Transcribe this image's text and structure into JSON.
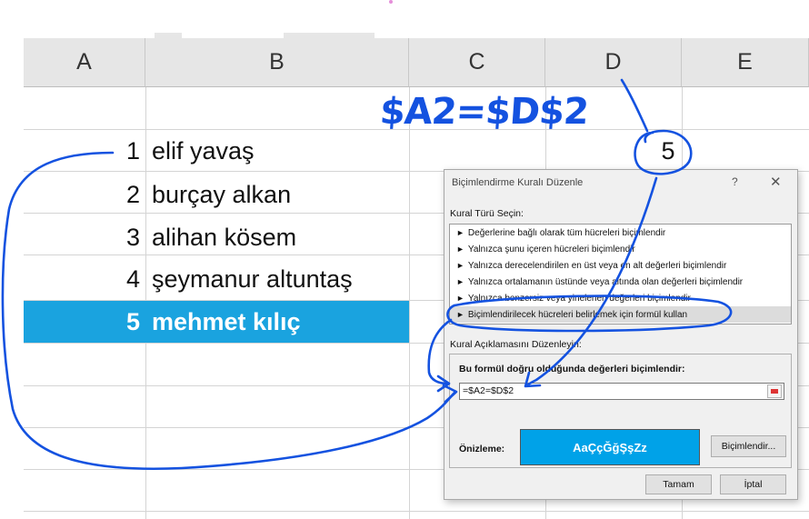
{
  "sheet": {
    "columns": [
      "A",
      "B",
      "C",
      "D",
      "E"
    ],
    "rows": [
      {
        "num": "1",
        "name": "elif yavaş"
      },
      {
        "num": "2",
        "name": "burçay alkan"
      },
      {
        "num": "3",
        "name": "alihan kösem"
      },
      {
        "num": "4",
        "name": "şeymanur altuntaş"
      },
      {
        "num": "5",
        "name": "mehmet kılıç"
      }
    ],
    "d1_value": "5",
    "selected_row_highlight": "#1aa3df"
  },
  "dialog": {
    "title": "Biçimlendirme Kuralı Düzenle",
    "help": "?",
    "close": "✕",
    "rule_type_label": "Kural Türü Seçin:",
    "rule_types": [
      "Değerlerine bağlı olarak tüm hücreleri biçimlendir",
      "Yalnızca şunu içeren hücreleri biçimlendir",
      "Yalnızca derecelendirilen en üst veya en alt değerleri biçimlendir",
      "Yalnızca ortalamanın üstünde veya altında olan değerleri biçimlendir",
      "Yalnızca benzersiz veya yinelenen değerleri biçimlendir",
      "Biçimlendirilecek hücreleri belirlemek için formül kullan"
    ],
    "description_label": "Kural Açıklamasını Düzenleyin:",
    "formula_label": "Bu formül doğru olduğunda değerleri biçimlendir:",
    "formula_value": "=$A2=$D$2",
    "preview_label": "Önizleme:",
    "preview_text": "AaÇçĞğŞşZz",
    "preview_color": "#00a2e8",
    "format_button": "Biçimlendir...",
    "ok_button": "Tamam",
    "cancel_button": "İptal"
  },
  "annotation": {
    "handwritten_formula": "$A2=$D$2",
    "ink_color": "#1452e0"
  }
}
